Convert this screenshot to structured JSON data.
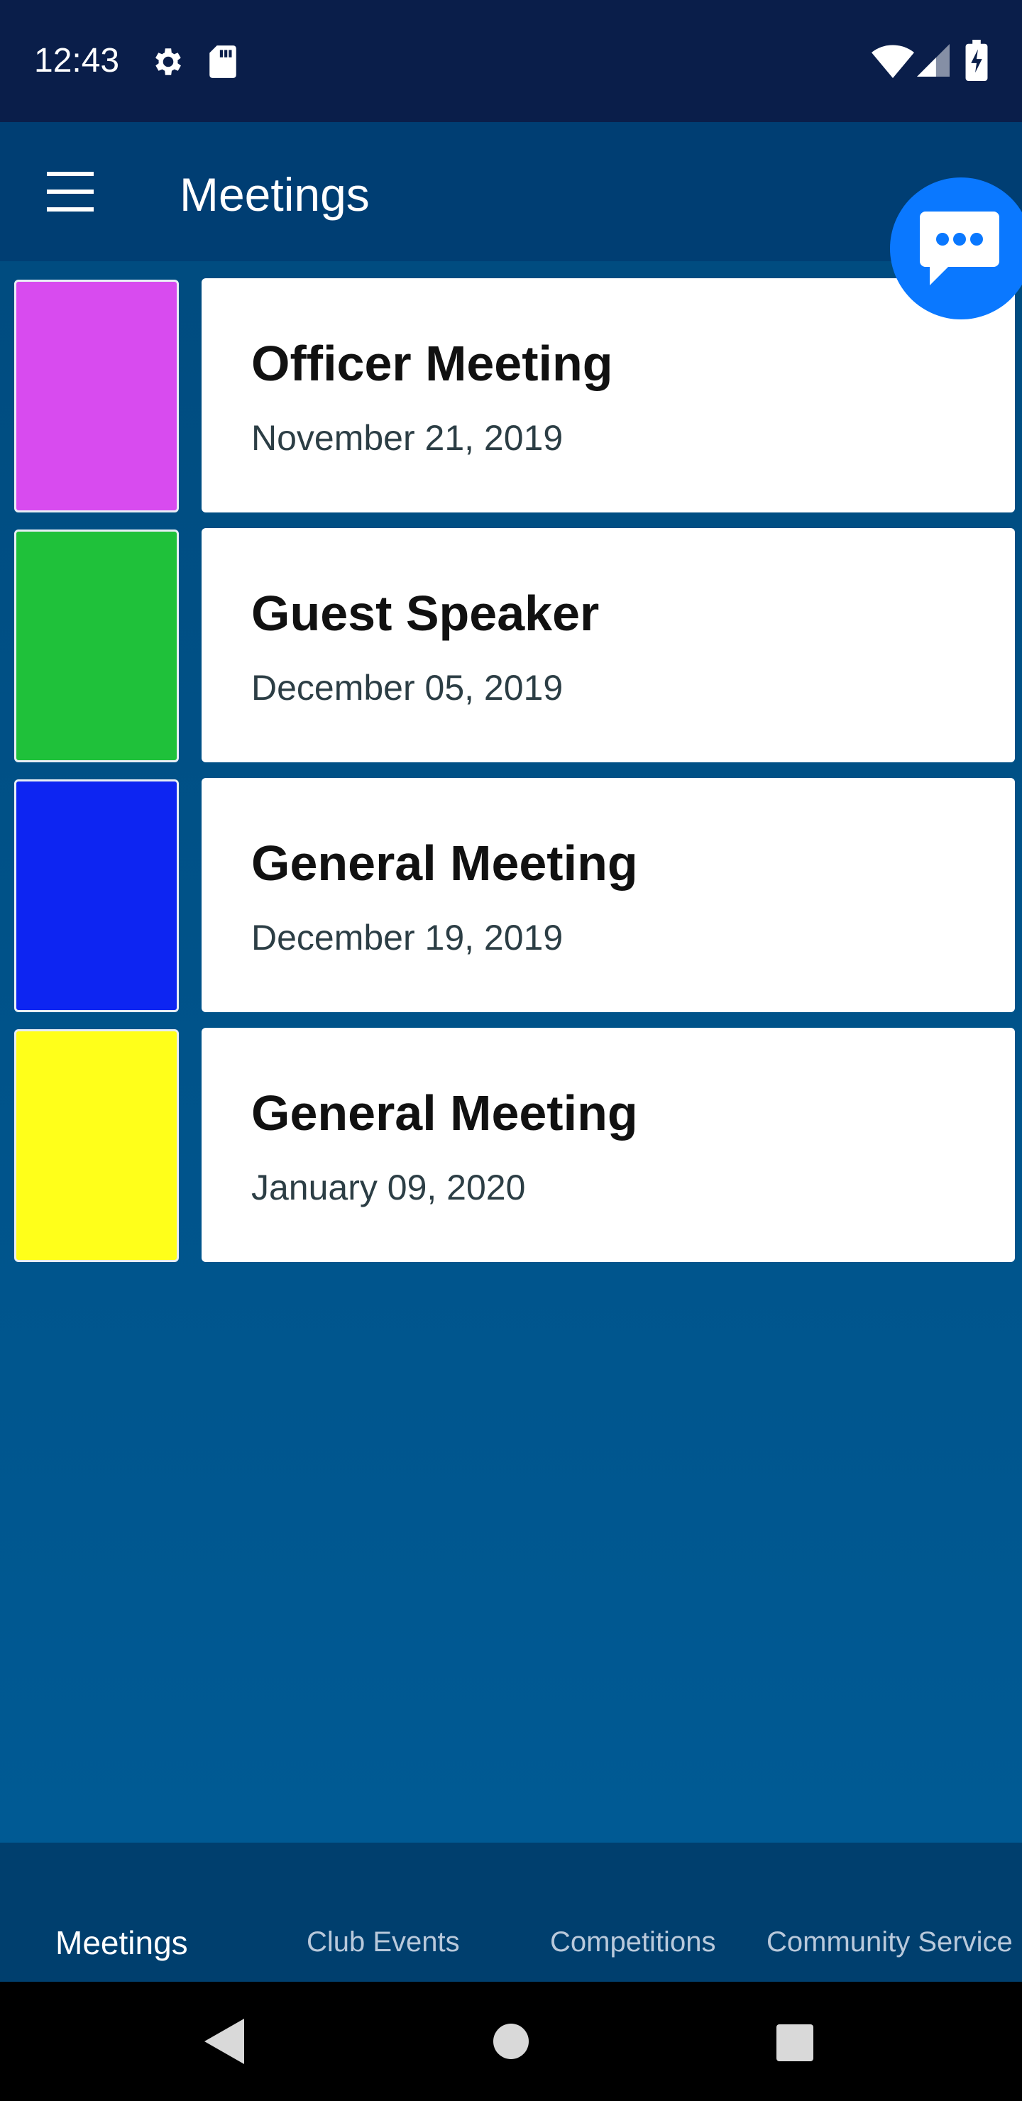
{
  "status_bar": {
    "time": "12:43",
    "icons": [
      "gear-icon",
      "sd-card-icon",
      "wifi-icon",
      "signal-icon",
      "battery-charging-icon"
    ]
  },
  "app_bar": {
    "title": "Meetings",
    "menu_icon": "hamburger-menu-icon"
  },
  "meetings": [
    {
      "title": "Officer Meeting",
      "date": "November 21, 2019",
      "color": "#d84bef"
    },
    {
      "title": "Guest Speaker",
      "date": "December 05, 2019",
      "color": "#1fc13a"
    },
    {
      "title": "General Meeting",
      "date": "December 19, 2019",
      "color": "#0d25f2"
    },
    {
      "title": "General Meeting",
      "date": "January 09, 2020",
      "color": "#ffff1a"
    }
  ],
  "fab": {
    "icon": "chat-bubble-icon",
    "color": "#0a78ff"
  },
  "bottom_nav": {
    "tabs": [
      "Meetings",
      "Club Events",
      "Competitions",
      "Community Service"
    ],
    "active": "Meetings"
  },
  "system_nav": {
    "icons": [
      "back-icon",
      "home-icon",
      "recents-icon"
    ]
  }
}
